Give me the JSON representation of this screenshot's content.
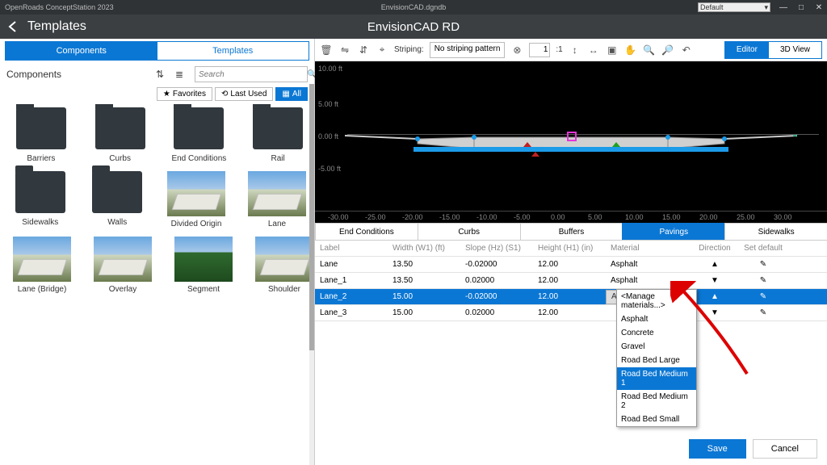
{
  "titlebar": {
    "app": "OpenRoads ConceptStation 2023",
    "file": "EnvisionCAD.dgndb",
    "profile": "Default"
  },
  "header": {
    "title": "Templates",
    "center": "EnvisionCAD RD"
  },
  "left": {
    "tabs": {
      "components": "Components",
      "templates": "Templates"
    },
    "label": "Components",
    "search_placeholder": "Search",
    "filters": {
      "favorites": "Favorites",
      "last_used": "Last Used",
      "all": "All"
    },
    "items": [
      {
        "label": "Barriers",
        "kind": "folder"
      },
      {
        "label": "Curbs",
        "kind": "folder"
      },
      {
        "label": "End Conditions",
        "kind": "folder"
      },
      {
        "label": "Rail",
        "kind": "folder"
      },
      {
        "label": "Sidewalks",
        "kind": "folder"
      },
      {
        "label": "Walls",
        "kind": "folder"
      },
      {
        "label": "Divided Origin",
        "kind": "thumb"
      },
      {
        "label": "Lane",
        "kind": "thumb"
      },
      {
        "label": "Lane (Bridge)",
        "kind": "thumb"
      },
      {
        "label": "Overlay",
        "kind": "thumb"
      },
      {
        "label": "Segment",
        "kind": "grass"
      },
      {
        "label": "Shoulder",
        "kind": "thumb"
      }
    ]
  },
  "toolbar": {
    "striping_label": "Striping:",
    "striping_value": "No striping pattern",
    "ratio": "1",
    "ratio_suffix": ":1",
    "editor": "Editor",
    "view3d": "3D View"
  },
  "chart_data": {
    "type": "cross-section",
    "y_ticks": [
      "10.00 ft",
      "5.00 ft",
      "0.00 ft",
      "-5.00 ft"
    ],
    "x_ticks": [
      "-30.00",
      "-25.00",
      "-20.00",
      "-15.00",
      "-10.00",
      "-5.00",
      "0.00",
      "5.00",
      "10.00",
      "15.00",
      "20.00",
      "25.00",
      "30.00"
    ]
  },
  "prop_tabs": [
    "End Conditions",
    "Curbs",
    "Buffers",
    "Pavings",
    "Sidewalks"
  ],
  "prop_tabs_active": 3,
  "columns": {
    "label": "Label",
    "width": "Width (W1) (ft)",
    "slope": "Slope (Hz) (S1)",
    "height": "Height (H1) (in)",
    "material": "Material",
    "direction": "Direction",
    "setdefault": "Set default"
  },
  "rows": [
    {
      "label": "Lane",
      "width": "13.50",
      "slope": "-0.02000",
      "height": "12.00",
      "material": "Asphalt",
      "dir": "up"
    },
    {
      "label": "Lane_1",
      "width": "13.50",
      "slope": "0.02000",
      "height": "12.00",
      "material": "Asphalt",
      "dir": "down"
    },
    {
      "label": "Lane_2",
      "width": "15.00",
      "slope": "-0.02000",
      "height": "12.00",
      "material": "Asphalt",
      "dir": "up",
      "selected": true
    },
    {
      "label": "Lane_3",
      "width": "15.00",
      "slope": "0.02000",
      "height": "12.00",
      "material": "",
      "dir": "down"
    }
  ],
  "dropdown": {
    "options": [
      "<Manage materials...>",
      "Asphalt",
      "Concrete",
      "Gravel",
      "Road Bed Large",
      "Road Bed Medium 1",
      "Road Bed Medium 2",
      "Road Bed Small"
    ],
    "hover_index": 5
  },
  "footer": {
    "save": "Save",
    "cancel": "Cancel"
  }
}
